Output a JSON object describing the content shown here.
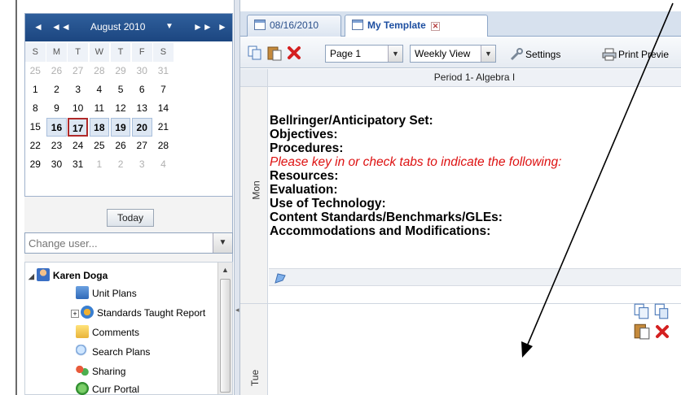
{
  "calendar": {
    "month_label": "August 2010",
    "nav": {
      "prev_year": "◄◄",
      "prev": "◄",
      "next": "►",
      "next_year": "►►",
      "month_menu": "▼"
    },
    "weekdays": [
      "S",
      "M",
      "T",
      "W",
      "T",
      "F",
      "S"
    ],
    "weeks": [
      [
        "25",
        "26",
        "27",
        "28",
        "29",
        "30",
        "31"
      ],
      [
        "1",
        "2",
        "3",
        "4",
        "5",
        "6",
        "7"
      ],
      [
        "8",
        "9",
        "10",
        "11",
        "12",
        "13",
        "14"
      ],
      [
        "15",
        "16",
        "17",
        "18",
        "19",
        "20",
        "21"
      ],
      [
        "22",
        "23",
        "24",
        "25",
        "26",
        "27",
        "28"
      ],
      [
        "29",
        "30",
        "31",
        "1",
        "2",
        "3",
        "4"
      ]
    ],
    "today_label": "Today"
  },
  "user_select": {
    "placeholder": "Change user..."
  },
  "tree": {
    "root": "Karen Doga",
    "items": [
      "Unit Plans",
      "Standards Taught Report",
      "Comments",
      "Search Plans",
      "Sharing",
      "Curr Portal"
    ]
  },
  "tabs": [
    {
      "label": "08/16/2010"
    },
    {
      "label": "My Template"
    }
  ],
  "toolbar": {
    "page_select": "Page 1",
    "view_select": "Weekly View",
    "settings_label": "Settings",
    "print_label": "Print Previe"
  },
  "planner": {
    "period_header": "Period 1- Algebra I",
    "days": [
      "Mon",
      "Tue"
    ],
    "lines": [
      "Bellringer/Anticipatory Set:",
      "Objectives:",
      "Procedures:",
      "Please key in or check tabs to indicate the following:",
      "Resources:",
      "Evaluation:",
      "Use of Technology:",
      "Content Standards/Benchmarks/GLEs:",
      "Accommodations and Modifications:"
    ]
  },
  "colors": {
    "calendar_header": "#1c4680",
    "highlight_red": "#d11111",
    "tab_text": "#1c4ea0"
  }
}
